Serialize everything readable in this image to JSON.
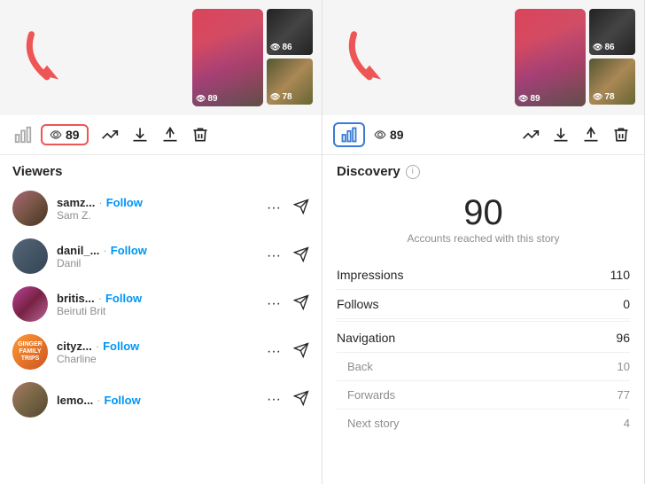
{
  "left_panel": {
    "story_thumbnails": [
      {
        "count": 89
      },
      {
        "count": 86
      },
      {
        "count": 78
      }
    ],
    "toolbar": {
      "viewer_count": "89",
      "icons": [
        "chart-bar",
        "trending-up",
        "download",
        "share",
        "trash"
      ]
    },
    "viewers_title": "Viewers",
    "viewers": [
      {
        "handle": "samz...",
        "follow": "Follow",
        "real_name": "Sam Z."
      },
      {
        "handle": "danil_...",
        "follow": "Follow",
        "real_name": "Danil"
      },
      {
        "handle": "britis...",
        "follow": "Follow",
        "real_name": "Beiruti Brit"
      },
      {
        "handle": "cityz...",
        "follow": "Follow",
        "real_name": "Charline"
      },
      {
        "handle": "lemo...",
        "follow": "Follow",
        "real_name": ""
      }
    ]
  },
  "right_panel": {
    "toolbar": {
      "viewer_count": "89",
      "icons": [
        "chart-bar",
        "trending-up",
        "download",
        "share",
        "trash"
      ]
    },
    "discovery_title": "Discovery",
    "reach_count": "90",
    "reach_label": "Accounts reached with this story",
    "metrics": [
      {
        "label": "Impressions",
        "value": "110",
        "sub": false
      },
      {
        "label": "Follows",
        "value": "0",
        "sub": false
      },
      {
        "label": "Navigation",
        "value": "96",
        "sub": false
      },
      {
        "label": "Back",
        "value": "10",
        "sub": true
      },
      {
        "label": "Forwards",
        "value": "77",
        "sub": true
      },
      {
        "label": "Next story",
        "value": "4",
        "sub": true
      }
    ]
  }
}
